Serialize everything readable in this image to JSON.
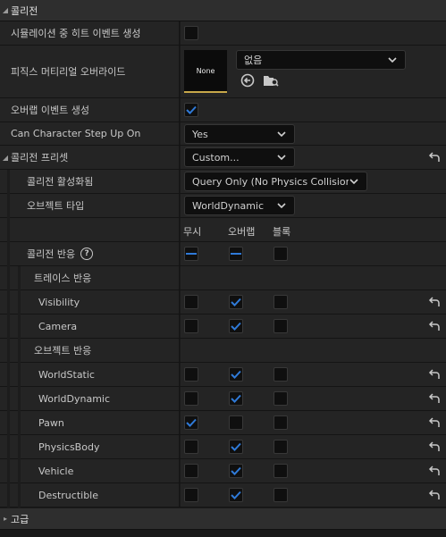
{
  "section_collision": {
    "title": "콜리전"
  },
  "section_advanced": {
    "title": "고급"
  },
  "props": {
    "sim_hit": {
      "label": "시뮬레이션 중 히트 이벤트 생성",
      "checked": false
    },
    "phys_override": {
      "label": "피직스 머티리얼 오버라이드",
      "thumb_label": "None",
      "combo_value": "없음"
    },
    "overlap_events": {
      "label": "오버랩 이벤트 생성",
      "checked": true
    },
    "step_up": {
      "label": "Can Character Step Up On",
      "value": "Yes"
    },
    "preset": {
      "label": "콜리전 프리셋",
      "value": "Custom..."
    },
    "enabled": {
      "label": "콜리전 활성화됨",
      "value": "Query Only (No Physics Collision)"
    },
    "object_type": {
      "label": "오브젝트 타입",
      "value": "WorldDynamic"
    }
  },
  "response_header": {
    "col_ignore": "무시",
    "col_overlap": "오버랩",
    "col_block": "블록"
  },
  "collision_response": {
    "label": "콜리전 반응"
  },
  "trace_response": {
    "label": "트레이스 반응",
    "rows": [
      {
        "label": "Visibility",
        "state": "overlap"
      },
      {
        "label": "Camera",
        "state": "overlap"
      }
    ]
  },
  "object_response": {
    "label": "오브젝트 반응",
    "rows": [
      {
        "label": "WorldStatic",
        "state": "overlap"
      },
      {
        "label": "WorldDynamic",
        "state": "overlap"
      },
      {
        "label": "Pawn",
        "state": "ignore"
      },
      {
        "label": "PhysicsBody",
        "state": "overlap"
      },
      {
        "label": "Vehicle",
        "state": "overlap"
      },
      {
        "label": "Destructible",
        "state": "overlap"
      }
    ]
  },
  "colors": {
    "accent": "#2f7ad8",
    "thumb_underline": "#c7a84a",
    "background": "#1a1a1a",
    "row": "#242424"
  },
  "icons": {
    "reset": "reset-arrow-icon",
    "browse": "browse-arrow-icon",
    "folder": "folder-search-icon",
    "help": "help-icon"
  }
}
